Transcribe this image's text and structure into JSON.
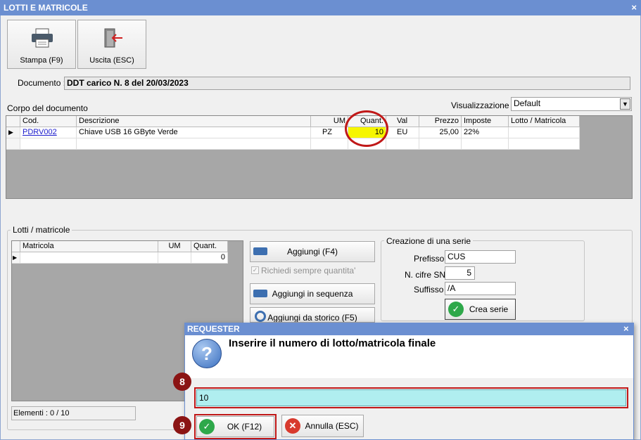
{
  "window": {
    "title": "LOTTI E MATRICOLE",
    "close": "×"
  },
  "toolbar": {
    "print_label": "Stampa (F9)",
    "exit_label": "Uscita (ESC)"
  },
  "document": {
    "label": "Documento :",
    "value": "DDT carico N. 8 del 20/03/2023"
  },
  "body": {
    "label": "Corpo del documento",
    "view_label": "Visualizzazione :",
    "view_value": "Default",
    "columns": [
      "Cod.",
      "Descrizione",
      "UM",
      "Quant.",
      "Val",
      "Prezzo",
      "Imposte",
      "Lotto / Matricola"
    ],
    "row": {
      "cod": "PDRV002",
      "descrizione": "Chiave USB 16 GByte Verde",
      "um": "PZ",
      "quant": "10",
      "val": "EU",
      "prezzo": "25,00",
      "imposte": "22%",
      "lotto": ""
    }
  },
  "lots": {
    "label": "Lotti / matricole",
    "columns": [
      "Matricola",
      "UM",
      "Quant."
    ],
    "row_quant": "0",
    "elements": "Elementi : 0 / 10",
    "add_label": "Aggiungi (F4)",
    "always_qty_label": "Richiedi sempre quantita'",
    "add_seq_label": "Aggiungi in sequenza",
    "add_hist_label": "Aggiungi da storico (F5)"
  },
  "series": {
    "label": "Creazione di una serie",
    "prefix_label": "Prefisso",
    "prefix_value": "CUS",
    "digits_label": "N. cifre SN",
    "digits_value": "5",
    "suffix_label": "Suffisso",
    "suffix_value": "/A",
    "create_label": "Crea serie"
  },
  "requester": {
    "title": "REQUESTER",
    "close": "×",
    "question_icon": "?",
    "prompt": "Inserire il numero di lotto/matricola finale",
    "input_value": "10",
    "ok_label": "OK (F12)",
    "cancel_label": "Annulla (ESC)"
  },
  "annotations": {
    "step8": "8",
    "step9": "9"
  }
}
